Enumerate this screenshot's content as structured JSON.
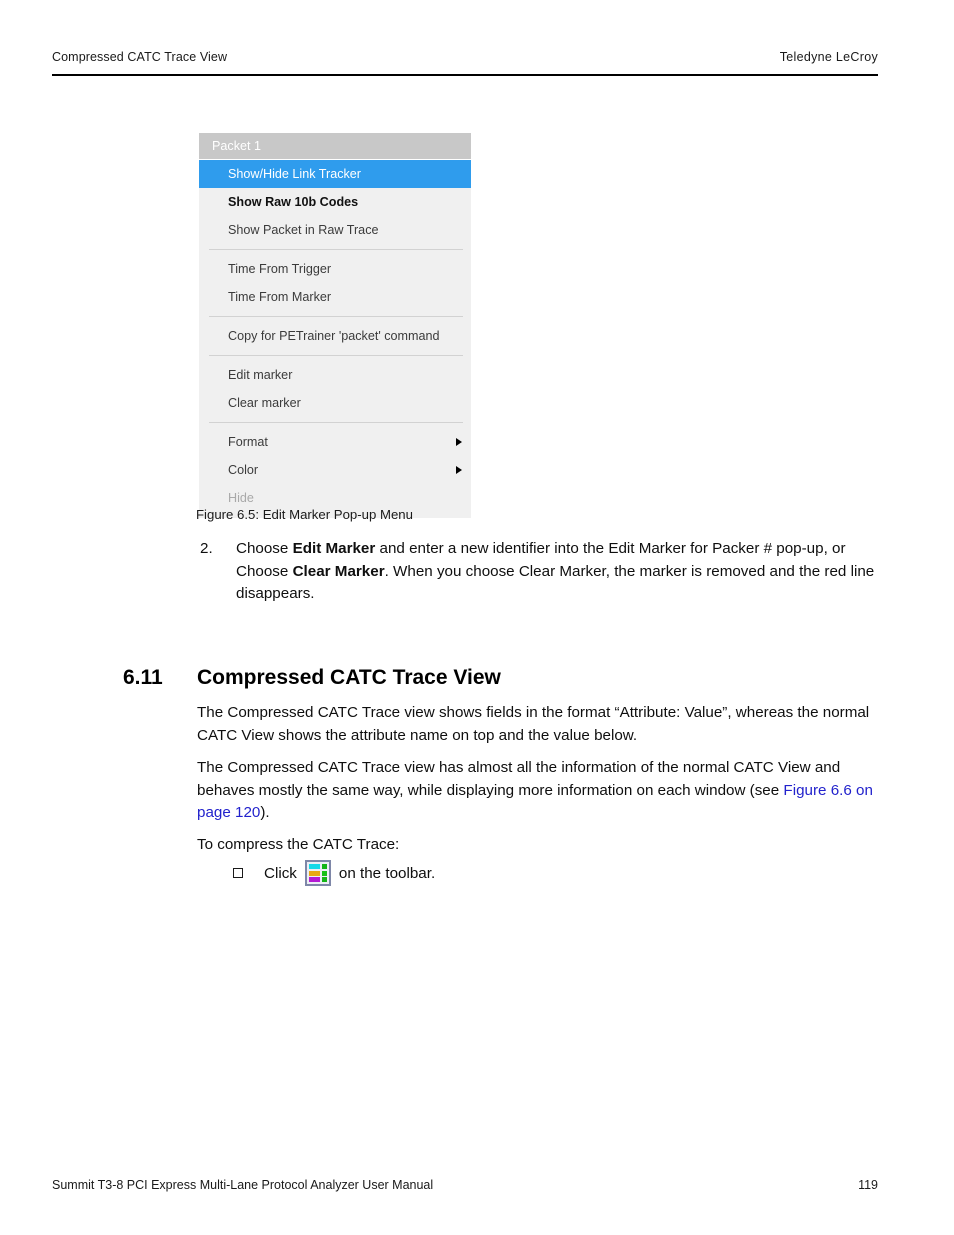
{
  "header": {
    "left_text": "Compressed CATC Trace View",
    "right_text": "Teledyne LeCroy"
  },
  "figure": {
    "caption": "Figure 6.5:  Edit Marker Pop-up Menu",
    "menu": {
      "title": "Packet 1",
      "highlight_color": "#2f9ced",
      "title_bg_color": "#c8c8c8",
      "background_color": "#f0f0f0",
      "items": [
        {
          "label": "Show/Hide Link Tracker",
          "state": "highlighted",
          "submenu": false
        },
        {
          "label": "Show Raw 10b Codes",
          "state": "bold",
          "submenu": false
        },
        {
          "label": "Show Packet in Raw Trace",
          "state": "normal",
          "submenu": false
        },
        {
          "label": "Time From Trigger",
          "state": "normal",
          "submenu": false
        },
        {
          "label": "Time From Marker",
          "state": "normal",
          "submenu": false
        },
        {
          "label": "Copy for PETrainer 'packet' command",
          "state": "normal",
          "submenu": false
        },
        {
          "label": "Edit marker",
          "state": "normal",
          "submenu": false
        },
        {
          "label": "Clear marker",
          "state": "normal",
          "submenu": false
        },
        {
          "label": "Format",
          "state": "normal",
          "submenu": true
        },
        {
          "label": "Color",
          "state": "normal",
          "submenu": true
        },
        {
          "label": "Hide",
          "state": "disabled",
          "submenu": false
        }
      ]
    }
  },
  "step": {
    "number": "2.",
    "line1_pre": "Choose ",
    "line1_bold": "Edit Marker",
    "line1_post": " and enter a new identifier into the Edit Marker for Packer # pop-up, or",
    "line2_pre": "Choose ",
    "line2_bold": "Clear Marker",
    "line2_post": ". When you choose Clear Marker, the marker is removed and the red line disappears."
  },
  "section": {
    "number": "6.11",
    "title": "Compressed CATC Trace View"
  },
  "body": {
    "paragraph_1": "The Compressed CATC Trace view shows fields in the format “Attribute: Value”, whereas the normal CATC View shows the attribute name on top and the value below.",
    "paragraph_2_pre": "The Compressed CATC Trace view has almost all the information of the normal CATC View and behaves mostly the same way, while displaying more information on each window (see ",
    "paragraph_2_link": "Figure 6.6 on page 120",
    "paragraph_2_post": ").",
    "paragraph_3": "To compress the CATC Trace:",
    "link_color": "#2222cc"
  },
  "bullet": {
    "text_before": "Click",
    "text_after": "on the toolbar.",
    "icon_name": "compress-catc-trace-toolbar-icon",
    "icon_colors": [
      "#17d9e8",
      "#13b516",
      "#e8a814",
      "#16c016",
      "#b41ad4",
      "#13b516"
    ]
  },
  "footer": {
    "left_text": "Summit T3-8 PCI Express Multi-Lane Protocol Analyzer User Manual",
    "page_number": "119"
  }
}
